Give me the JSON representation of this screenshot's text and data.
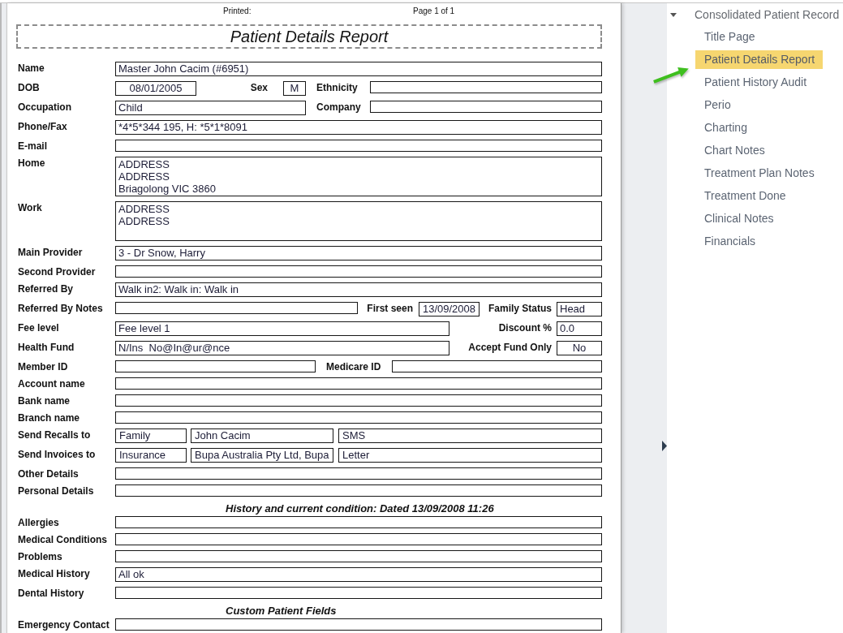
{
  "report": {
    "printed_label": "Printed:",
    "page_label": "Page 1 of 1",
    "title": "Patient Details Report",
    "sections": [
      {
        "rows": [
          {
            "kind": "single",
            "label": "Name",
            "value": "Master John Cacim (#6951)"
          },
          {
            "kind": "personal",
            "label": "DOB",
            "fields": [
              {
                "kind": "date",
                "value": "08/01/2005"
              },
              {
                "kind": "code",
                "label": "Sex",
                "value": "M"
              },
              {
                "kind": "text",
                "label": "Ethnicity"
              }
            ]
          },
          {
            "kind": "occupation",
            "label": "Occupation",
            "fields": [
              {
                "kind": "text",
                "value": "Child"
              },
              {
                "kind": "text",
                "label": "Company"
              }
            ]
          },
          {
            "kind": "single",
            "label": "Phone/Fax",
            "value": "*4*5*344 195, H: *5*1*8091"
          },
          {
            "kind": "single",
            "label": "E-mail"
          },
          {
            "kind": "address",
            "label": "Home",
            "value": "ADDRESS\nADDRESS\nBriagolong VIC 3860"
          },
          {
            "kind": "address",
            "label": "Work",
            "value": "ADDRESS\nADDRESS"
          },
          {
            "kind": "single",
            "label": "Main Provider",
            "value": "3 - Dr Snow, Harry"
          },
          {
            "kind": "single",
            "label": "Second Provider"
          },
          {
            "kind": "single",
            "label": "Referred By",
            "value": "Walk in2: Walk in: Walk in"
          },
          {
            "kind": "referral",
            "label": "Referred By Notes",
            "fields": [
              {
                "kind": "text"
              },
              {
                "kind": "date",
                "label": "First seen",
                "value": "13/09/2008"
              },
              {
                "kind": "text",
                "label": "Family Status",
                "value": "Head"
              }
            ]
          },
          {
            "kind": "fee",
            "label": "Fee level",
            "fields": [
              {
                "kind": "text",
                "value": "Fee level 1"
              },
              {
                "kind": "text",
                "label": "Discount %",
                "value": "0.0"
              }
            ]
          },
          {
            "kind": "fee",
            "label": "Health Fund",
            "fields": [
              {
                "kind": "text",
                "value": "N/Ins  No@In@ur@nce"
              },
              {
                "kind": "flag",
                "label": "Accept Fund Only",
                "value": "No"
              }
            ]
          },
          {
            "kind": "ids",
            "label": "Member ID",
            "fields": [
              {
                "kind": "text"
              },
              {
                "kind": "text",
                "label": "Medicare ID"
              }
            ]
          },
          {
            "kind": "single",
            "label": "Account name"
          },
          {
            "kind": "single",
            "label": "Bank name"
          },
          {
            "kind": "single",
            "label": "Branch name"
          },
          {
            "kind": "contact",
            "label": "Send Recalls to",
            "fields": [
              {
                "kind": "text",
                "value": "Family"
              },
              {
                "kind": "text",
                "value": "John Cacim"
              },
              {
                "kind": "text",
                "value": "SMS"
              }
            ]
          },
          {
            "kind": "contact",
            "label": "Send Invoices to",
            "fields": [
              {
                "kind": "text",
                "value": "Insurance"
              },
              {
                "kind": "text",
                "value": "Bupa Australia Pty Ltd, Bupa"
              },
              {
                "kind": "text",
                "value": "Letter"
              }
            ]
          },
          {
            "kind": "single",
            "label": "Other Details"
          },
          {
            "kind": "single",
            "label": "Personal Details"
          }
        ]
      },
      {
        "heading": "History and current condition: Dated 13/09/2008 11:26",
        "rows": [
          {
            "kind": "single",
            "label": "Allergies"
          },
          {
            "kind": "single",
            "label": "Medical Conditions"
          },
          {
            "kind": "single",
            "label": "Problems"
          },
          {
            "kind": "single",
            "label": "Medical History",
            "value": "All ok"
          },
          {
            "kind": "single",
            "label": "Dental History"
          }
        ]
      },
      {
        "heading": "Custom Patient Fields",
        "rows": [
          {
            "kind": "single",
            "label": "Emergency Contact"
          }
        ]
      }
    ]
  },
  "sidebar": {
    "title": "Consolidated Patient Record",
    "expanded": true,
    "items": [
      {
        "label": "Title Page",
        "selected": false
      },
      {
        "label": "Patient Details Report",
        "selected": true
      },
      {
        "label": "Patient History Audit",
        "selected": false
      },
      {
        "label": "Perio",
        "selected": false
      },
      {
        "label": "Charting",
        "selected": false
      },
      {
        "label": "Chart Notes",
        "selected": false
      },
      {
        "label": "Treatment Plan Notes",
        "selected": false
      },
      {
        "label": "Treatment Done",
        "selected": false
      },
      {
        "label": "Clinical Notes",
        "selected": false
      },
      {
        "label": "Financials",
        "selected": false
      }
    ]
  }
}
